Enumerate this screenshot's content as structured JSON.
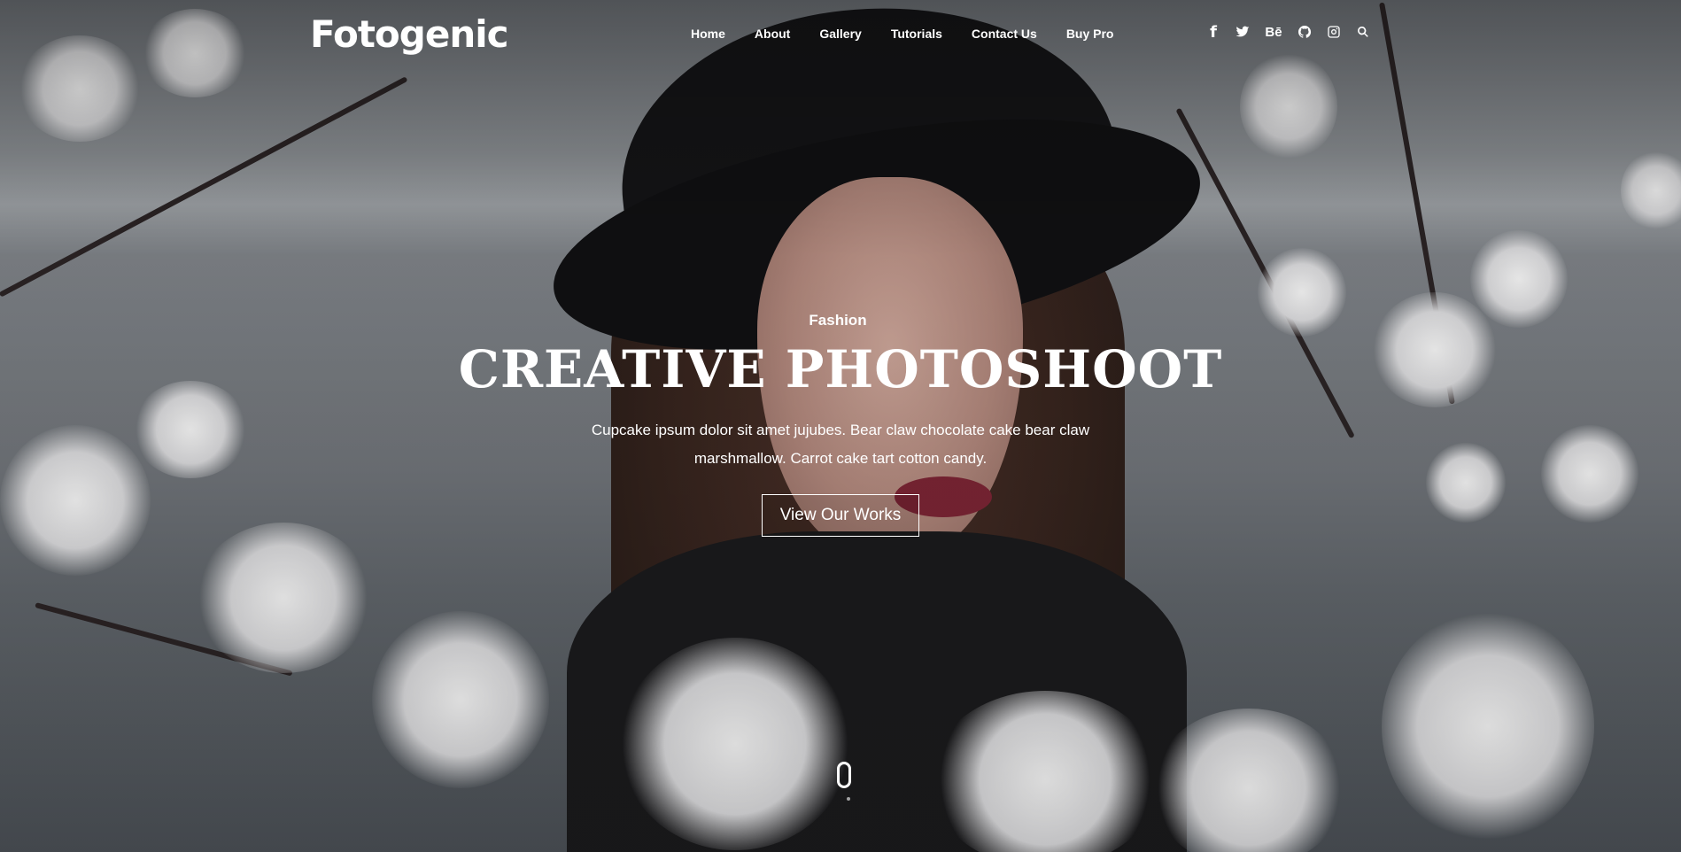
{
  "header": {
    "logo": "Fotogenic",
    "nav": [
      {
        "label": "Home"
      },
      {
        "label": "About"
      },
      {
        "label": "Gallery"
      },
      {
        "label": "Tutorials"
      },
      {
        "label": "Contact Us"
      },
      {
        "label": "Buy Pro"
      }
    ],
    "social": [
      {
        "icon": "facebook-icon",
        "glyph": "f"
      },
      {
        "icon": "twitter-icon",
        "glyph": ""
      },
      {
        "icon": "behance-icon",
        "glyph": "Bē"
      },
      {
        "icon": "github-icon",
        "glyph": ""
      },
      {
        "icon": "instagram-icon",
        "glyph": ""
      },
      {
        "icon": "search-icon",
        "glyph": ""
      }
    ]
  },
  "hero": {
    "category": "Fashion",
    "headline": "CREATIVE PHOTOSHOOT",
    "description": "Cupcake ipsum dolor sit amet jujubes. Bear claw chocolate cake bear claw marshmallow. Carrot cake tart cotton candy.",
    "cta_label": "View Our Works"
  },
  "colors": {
    "text": "#ffffff",
    "hat": "#141416",
    "lips": "#7a2434"
  }
}
